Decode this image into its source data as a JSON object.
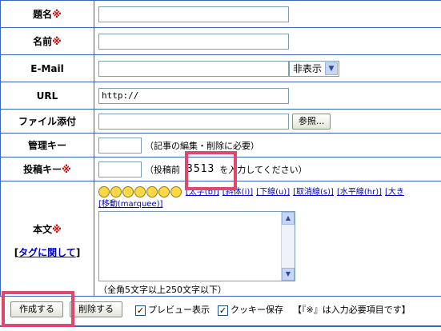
{
  "rows": {
    "subject": {
      "label": "題名",
      "req": "※"
    },
    "name": {
      "label": "名前",
      "req": "※"
    },
    "email": {
      "label": "E-Mail",
      "select_value": "非表示"
    },
    "url": {
      "label": "URL",
      "value": "http://"
    },
    "attach": {
      "label": "ファイル添付",
      "browse_label": "参照..."
    },
    "admin_key": {
      "label": "管理キー",
      "note": "（記事の編集・削除に必要）"
    },
    "post_key": {
      "label": "投稿キー",
      "req": "※",
      "note_prefix": "（投稿前",
      "code": "3513",
      "note_suffix": "を入力してください）"
    },
    "body": {
      "label": "本文",
      "req": "※",
      "tag_link_prefix": "[",
      "tag_link": "タグに関して",
      "tag_link_suffix": "]",
      "tags": [
        "[太字(b)]",
        "[斜体(i)]",
        "[下線(u)]",
        "[取消線(s)]",
        "[水平線(hr)]",
        "[大き"
      ],
      "marquee": "[移動(marquee)]",
      "length_note": "（全角5文字以上250文字以下）",
      "emoticons": [
        "smile-laugh",
        "smile",
        "smile-wink",
        "smile-cry",
        "smile-tongue",
        "smile-grin",
        "sad"
      ]
    }
  },
  "bottom": {
    "create_label": "作成する",
    "delete_label": "削除する",
    "preview_label": "プレビュー表示",
    "cookie_label": "クッキー保存",
    "required_note": "【『※』は入力必要項目です】"
  },
  "colors": {
    "accent": "#3a66b8",
    "required": "#dd0000",
    "highlight": "#e0466e"
  }
}
